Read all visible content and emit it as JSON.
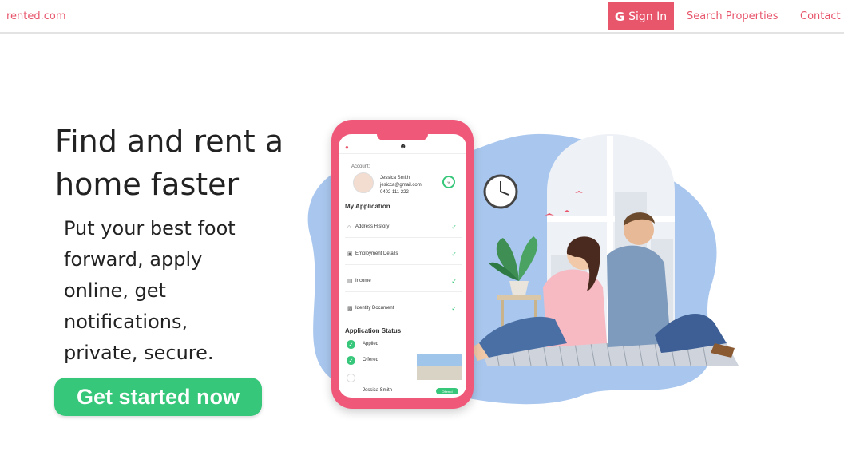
{
  "nav": {
    "brand": "rented.com",
    "signin_icon": "G",
    "signin_label": "Sign In",
    "links": [
      "Search Properties",
      "Contact"
    ]
  },
  "hero": {
    "title": "Find and rent a home faster",
    "subtitle": "Put your best foot forward, apply online, get notifications, private, secure.",
    "cta": "Get started now"
  },
  "phone": {
    "account_label": "Account:",
    "name": "Jessica Smith",
    "email": "jesicca@gmail.com",
    "phone_number": "0402 111 222",
    "progress": "%",
    "my_application": "My Application",
    "items": [
      "Address History",
      "Employment Details",
      "Income",
      "Identity Document"
    ],
    "application_status": "Application Status",
    "statuses": [
      "Applied",
      "Offered"
    ],
    "applicant": "Jessica Smith",
    "badge": "Offered"
  },
  "colors": {
    "brand": "#e8566c",
    "cta": "#37c77a",
    "phone": "#f0587a",
    "blob": "#a9c7ee"
  }
}
